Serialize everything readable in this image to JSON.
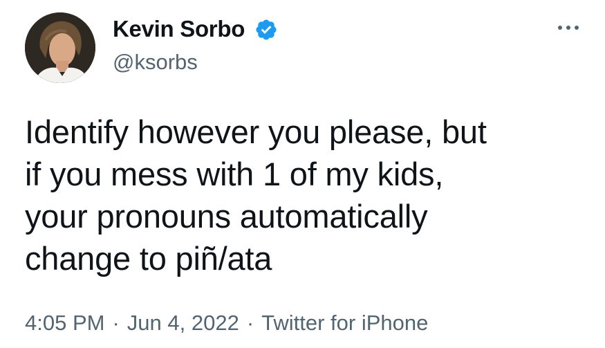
{
  "author": {
    "display_name": "Kevin Sorbo",
    "handle": "@ksorbs",
    "verified": true,
    "avatar_icon": "profile-photo",
    "verified_icon": "verified-badge-icon"
  },
  "menu": {
    "icon": "more-options-icon"
  },
  "tweet": {
    "text": "Identify however you please, but\nif you mess with 1 of my kids,\nyour pronouns automatically\nchange to piñ/ata"
  },
  "meta": {
    "time": "4:05 PM",
    "date": "Jun 4, 2022",
    "source": "Twitter for iPhone",
    "separator": "·"
  },
  "colors": {
    "text_primary": "#0f1419",
    "text_secondary": "#536471",
    "verified_blue": "#1d9bf0",
    "background": "#ffffff"
  }
}
